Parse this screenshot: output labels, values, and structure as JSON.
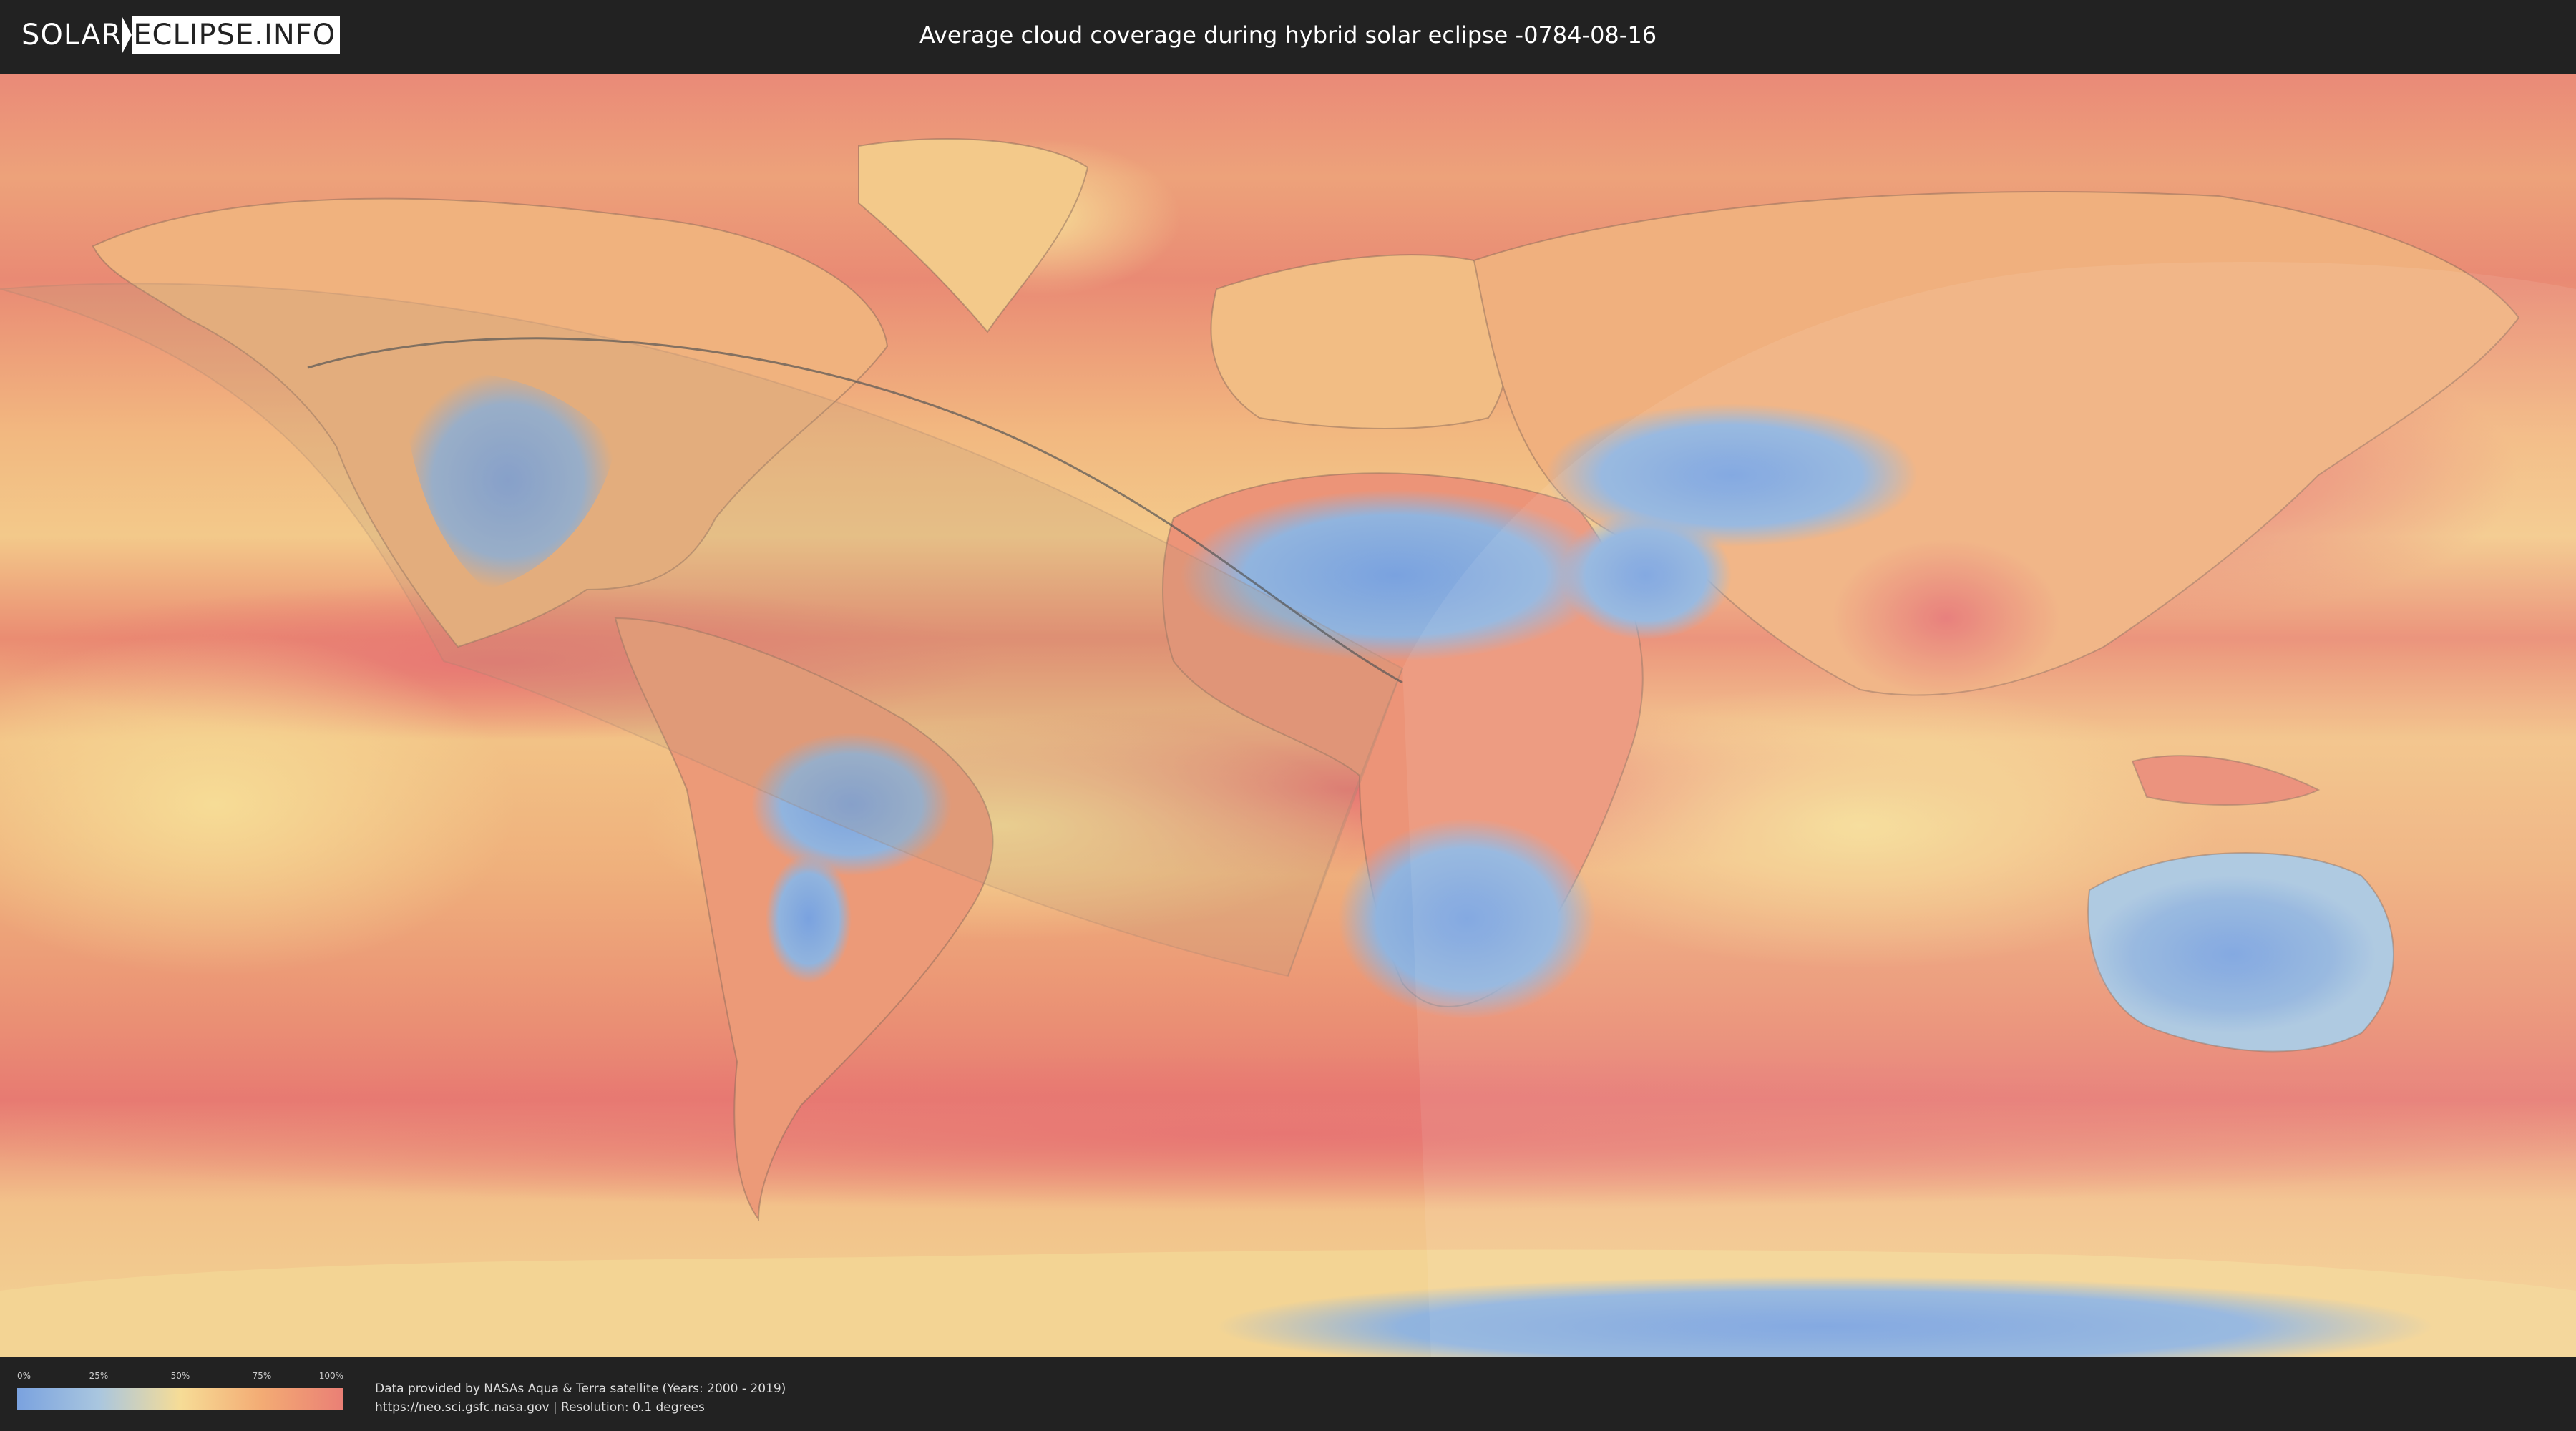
{
  "header": {
    "logo_solar": "SOLAR",
    "logo_eclipse": "ECLIPSE.INFO",
    "title": "Average cloud coverage during hybrid solar eclipse -0784-08-16"
  },
  "map": {
    "description_colors": {
      "clear": "#7aa2df",
      "low": "#a9c6df",
      "mid": "#f6dc96",
      "high": "#f3ab74",
      "overcast": "#ea7f75"
    }
  },
  "legend": {
    "ticks": [
      "0%",
      "25%",
      "50%",
      "75%",
      "100%"
    ]
  },
  "footer": {
    "credit_line1": "Data provided by NASAs Aqua & Terra satellite (Years: 2000 - 2019)",
    "credit_line2": "https://neo.sci.gsfc.nasa.gov | Resolution: 0.1 degrees"
  }
}
